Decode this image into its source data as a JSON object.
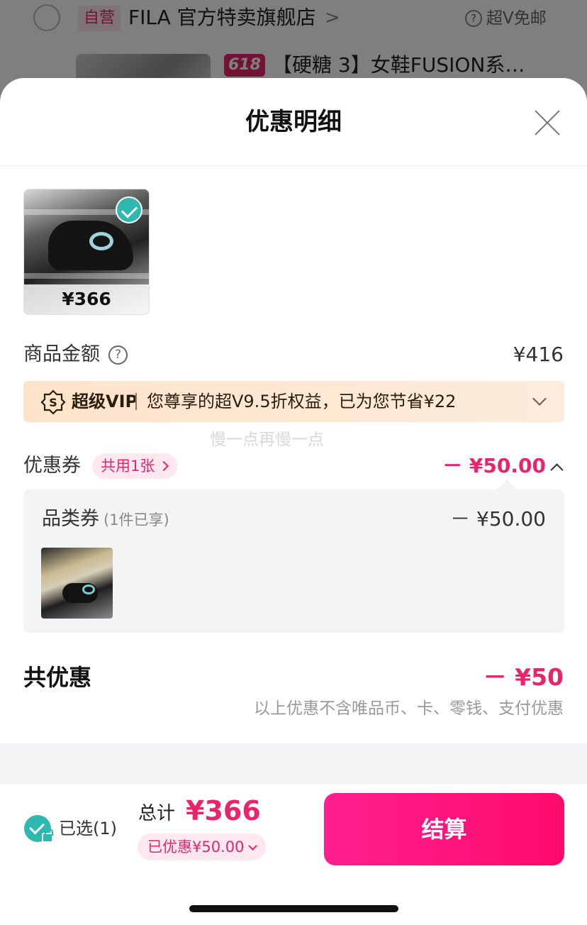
{
  "background": {
    "badge": "自营",
    "store_name": "FILA 官方特卖旗舰店",
    "store_chevron": ">",
    "vip_shipping": "超V免邮",
    "promo_badge": "618",
    "product_title": "【硬糖 3】女鞋FUSION系…"
  },
  "sheet": {
    "title": "优惠明细"
  },
  "product": {
    "price": "¥366"
  },
  "goods_amount": {
    "label": "商品金额",
    "help_icon": "?",
    "value": "¥416"
  },
  "vip": {
    "brand": "超级VIP",
    "text": "您尊享的超V9.5折权益，已为您节省¥22"
  },
  "watermark": "慢一点再慢一点",
  "coupon": {
    "label": "优惠券",
    "tag": "共用1张",
    "total": "－ ¥50.00",
    "item": {
      "title": "品类券",
      "sub": "(1件已享)",
      "amount": "－ ¥50.00"
    }
  },
  "total_discount": {
    "label": "共优惠",
    "value": "－ ¥50",
    "note": "以上优惠不含唯品币、卡、零钱、支付优惠"
  },
  "bottom": {
    "selected": "已选(1)",
    "total_label": "总计",
    "total_price": "¥366",
    "saved": "已优惠¥50.00",
    "checkout": "结算"
  },
  "colors": {
    "accent": "#e8246c",
    "checkout": "#ff0a6c",
    "check": "#2fb8b0",
    "vip_bg": "#fde3c9"
  }
}
